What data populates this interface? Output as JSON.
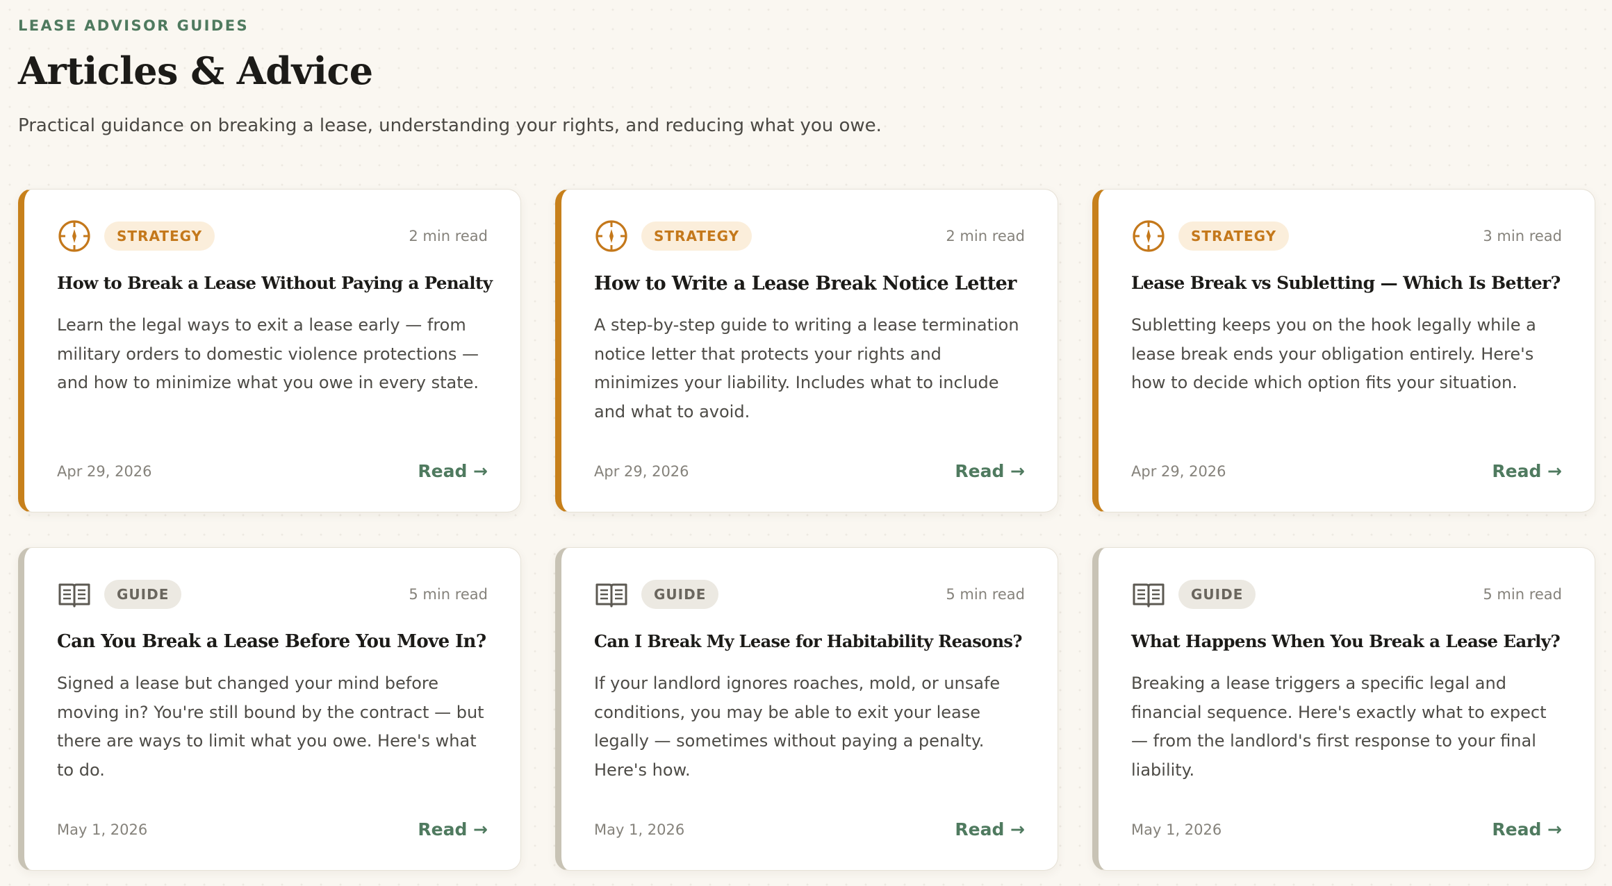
{
  "header": {
    "eyebrow": "LEASE ADVISOR GUIDES",
    "title": "Articles & Advice",
    "subtitle": "Practical guidance on breaking a lease, understanding your rights, and reducing what you owe."
  },
  "colors": {
    "accent_green": "#4f7a5f",
    "strategy_orange": "#c7801b",
    "guide_gray": "#c8c3b5",
    "background": "#faf7f1"
  },
  "cards": [
    {
      "category": "STRATEGY",
      "icon": "compass-icon",
      "read_time": "2 min read",
      "title": "How to Break a Lease Without Paying a Penalty",
      "description": "Learn the legal ways to exit a lease early — from military orders to domestic violence protections — and how to minimize what you owe in every state.",
      "date": "Apr 29, 2026",
      "link": "Read →"
    },
    {
      "category": "STRATEGY",
      "icon": "compass-icon",
      "read_time": "2 min read",
      "title": "How to Write a Lease Break Notice Letter",
      "description": "A step-by-step guide to writing a lease termination notice letter that protects your rights and minimizes your liability. Includes what to include and what to avoid.",
      "date": "Apr 29, 2026",
      "link": "Read →"
    },
    {
      "category": "STRATEGY",
      "icon": "compass-icon",
      "read_time": "3 min read",
      "title": "Lease Break vs Subletting — Which Is Better?",
      "description": "Subletting keeps you on the hook legally while a lease break ends your obligation entirely. Here's how to decide which option fits your situation.",
      "date": "Apr 29, 2026",
      "link": "Read →"
    },
    {
      "category": "GUIDE",
      "icon": "book-icon",
      "read_time": "5 min read",
      "title": "Can You Break a Lease Before You Move In?",
      "description": "Signed a lease but changed your mind before moving in? You're still bound by the contract — but there are ways to limit what you owe. Here's what to do.",
      "date": "May 1, 2026",
      "link": "Read →"
    },
    {
      "category": "GUIDE",
      "icon": "book-icon",
      "read_time": "5 min read",
      "title": "Can I Break My Lease for Habitability Reasons?",
      "description": "If your landlord ignores roaches, mold, or unsafe conditions, you may be able to exit your lease legally — sometimes without paying a penalty. Here's how.",
      "date": "May 1, 2026",
      "link": "Read →"
    },
    {
      "category": "GUIDE",
      "icon": "book-icon",
      "read_time": "5 min read",
      "title": "What Happens When You Break a Lease Early?",
      "description": "Breaking a lease triggers a specific legal and financial sequence. Here's exactly what to expect — from the landlord's first response to your final liability.",
      "date": "May 1, 2026",
      "link": "Read →"
    }
  ]
}
